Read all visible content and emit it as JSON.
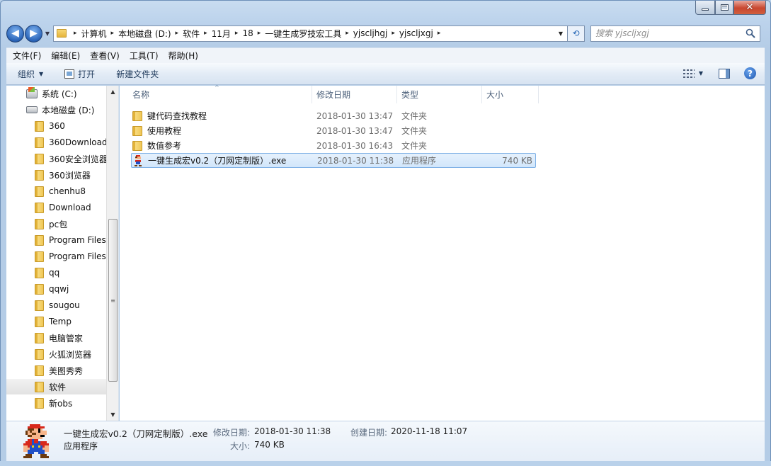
{
  "caption": {
    "min_icon": "minimize-icon",
    "max_icon": "maximize-icon",
    "close_glyph": "✕"
  },
  "nav": {
    "back_glyph": "◀",
    "forward_glyph": "▶",
    "dropdown_glyph": "▼",
    "refresh_glyph": "⟲"
  },
  "address": {
    "crumbs": [
      "计算机",
      "本地磁盘 (D:)",
      "软件",
      "11月",
      "18",
      "一键生成罗技宏工具",
      "yjscljhgj",
      "yjscljxgj"
    ],
    "sep": "▸"
  },
  "search": {
    "placeholder": "搜索 yjscljxgj"
  },
  "menu": [
    "文件(F)",
    "编辑(E)",
    "查看(V)",
    "工具(T)",
    "帮助(H)"
  ],
  "toolbar": {
    "organize": "组织",
    "open": "打开",
    "new_folder": "新建文件夹"
  },
  "tree": [
    {
      "label": "系统 (C:)",
      "kind": "sysdrive"
    },
    {
      "label": "本地磁盘 (D:)",
      "kind": "drive"
    },
    {
      "label": "360",
      "kind": "folder"
    },
    {
      "label": "360Download",
      "kind": "folder"
    },
    {
      "label": "360安全浏览器",
      "kind": "folder"
    },
    {
      "label": "360浏览器",
      "kind": "folder"
    },
    {
      "label": "chenhu8",
      "kind": "folder"
    },
    {
      "label": "Download",
      "kind": "folder"
    },
    {
      "label": "pc包",
      "kind": "folder"
    },
    {
      "label": "Program Files",
      "kind": "folder"
    },
    {
      "label": "Program Files",
      "kind": "folder"
    },
    {
      "label": "qq",
      "kind": "folder"
    },
    {
      "label": "qqwj",
      "kind": "folder"
    },
    {
      "label": "sougou",
      "kind": "folder"
    },
    {
      "label": "Temp",
      "kind": "folder"
    },
    {
      "label": "电脑管家",
      "kind": "folder"
    },
    {
      "label": "火狐浏览器",
      "kind": "folder"
    },
    {
      "label": "美图秀秀",
      "kind": "folder"
    },
    {
      "label": "软件",
      "kind": "folder",
      "selected": true
    },
    {
      "label": "新obs",
      "kind": "folder"
    }
  ],
  "columns": {
    "name": "名称",
    "date": "修改日期",
    "type": "类型",
    "size": "大小"
  },
  "files": [
    {
      "name": "键代码查找教程",
      "date": "2018-01-30 13:47",
      "type": "文件夹",
      "size": "",
      "kind": "folder"
    },
    {
      "name": "使用教程",
      "date": "2018-01-30 13:47",
      "type": "文件夹",
      "size": "",
      "kind": "folder"
    },
    {
      "name": "数值参考",
      "date": "2018-01-30 16:43",
      "type": "文件夹",
      "size": "",
      "kind": "folder"
    },
    {
      "name": "一键生成宏v0.2（刀网定制版）.exe",
      "date": "2018-01-30 11:38",
      "type": "应用程序",
      "size": "740 KB",
      "kind": "exe",
      "selected": true
    }
  ],
  "details": {
    "filename": "一键生成宏v0.2（刀网定制版）.exe",
    "filetype": "应用程序",
    "modified_label": "修改日期:",
    "modified_value": "2018-01-30 11:38",
    "created_label": "创建日期:",
    "created_value": "2020-11-18 11:07",
    "size_label": "大小:",
    "size_value": "740 KB"
  }
}
